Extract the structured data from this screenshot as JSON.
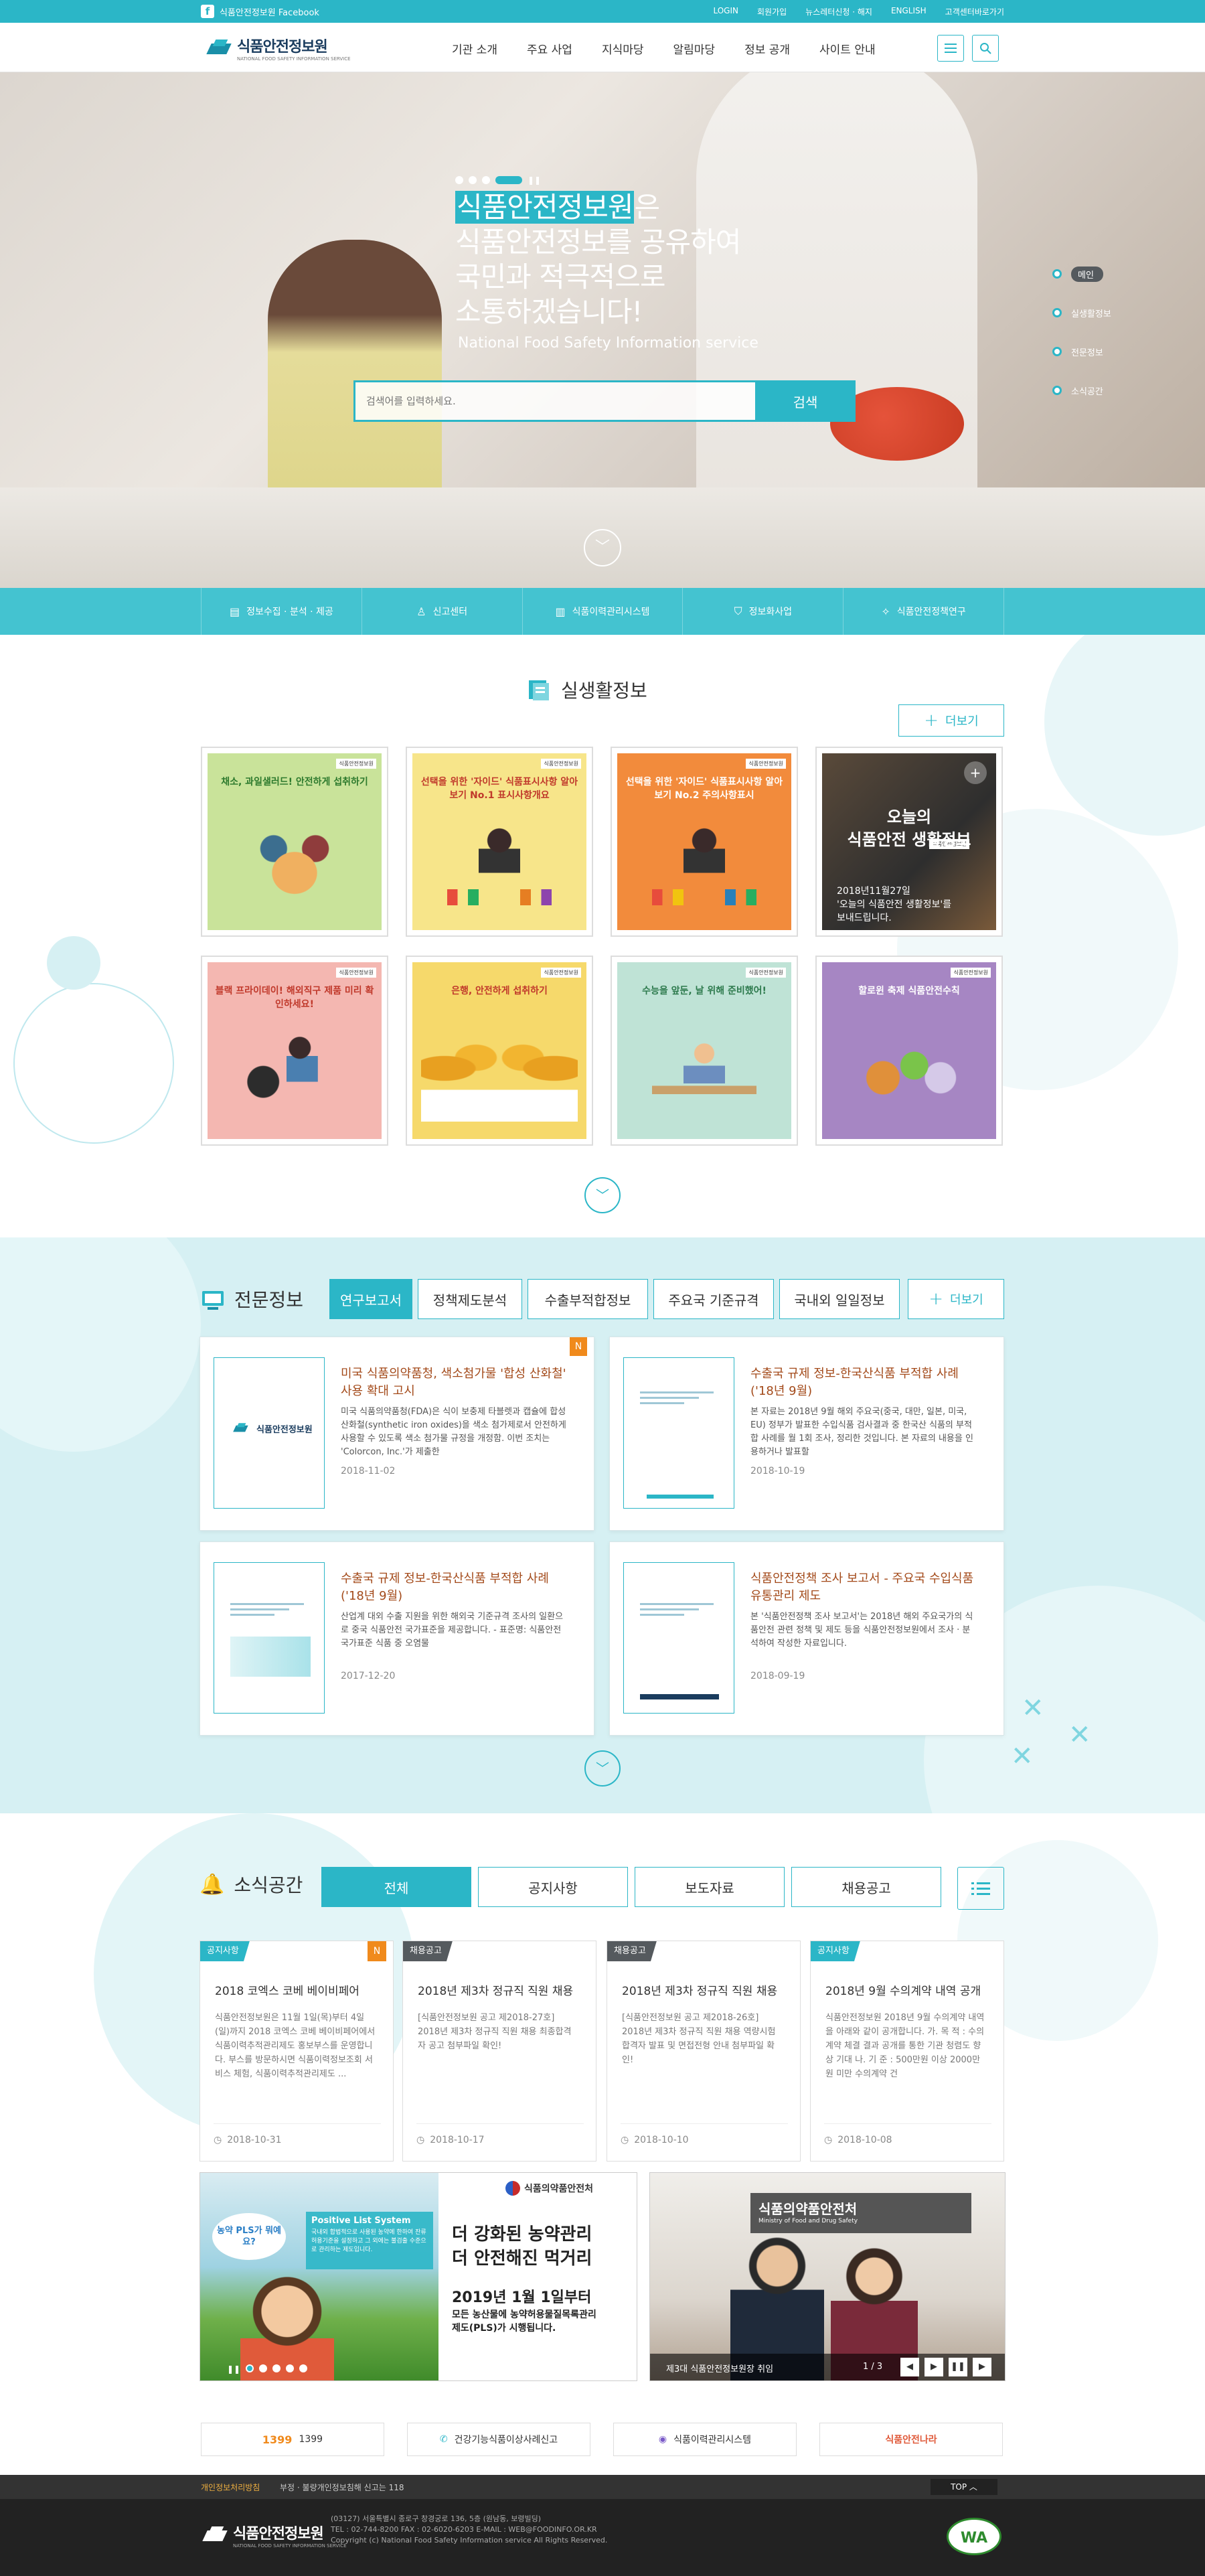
{
  "topbar": {
    "facebook": "식품안전정보원 Facebook",
    "util": [
      "LOGIN",
      "회원가입",
      "뉴스레터신청 · 해지",
      "ENGLISH",
      "고객센터바로가기"
    ]
  },
  "header": {
    "logo": "식품안전정보원",
    "logo_sub": "NATIONAL FOOD SAFETY INFORMATION SERVICE",
    "nav": [
      "기관 소개",
      "주요 사업",
      "지식마당",
      "알림마당",
      "정보 공개",
      "사이트 안내"
    ],
    "icons": [
      "menu-icon",
      "search-icon"
    ]
  },
  "hero": {
    "title_highlight": "식품안전정보원",
    "title_rest": "은",
    "title_line2": "식품안전정보를 공유하여",
    "title_line3": "국민과 적극적으로",
    "title_line4": "소통하겠습니다!",
    "subtitle": "National Food Safety Information service",
    "search_placeholder": "검색어를 입력하세요.",
    "search_button": "검색",
    "side_nav": [
      "메인",
      "실생활정보",
      "전문정보",
      "소식공간"
    ],
    "down_icon": "chevron-down-icon"
  },
  "quick": [
    {
      "label": "정보수집 · 분석 · 제공",
      "icon": "document-icon"
    },
    {
      "label": "신고센터",
      "icon": "person-icon"
    },
    {
      "label": "식품이력관리시스템",
      "icon": "barcode-icon"
    },
    {
      "label": "정보화사업",
      "icon": "shield-icon"
    },
    {
      "label": "식품안전정책연구",
      "icon": "handshake-icon"
    }
  ],
  "life": {
    "title": "실생활정보",
    "more": "더보기",
    "cards": [
      {
        "title": "채소, 과일샐러드! 안전하게 섭취하기",
        "bg": "#c9e39a",
        "title_color": "#2d7a2d"
      },
      {
        "title": "선택을 위한 '자이드' 식품표시사항 알아보기 No.1 표시사항개요",
        "bg": "#f7e58a",
        "title_color": "#c0392b"
      },
      {
        "title": "선택을 위한 '자이드' 식품표시사항 알아보기 No.2 주의사항표시",
        "bg": "#f28b3c",
        "title_color": "#ffffff"
      },
      {
        "title": "",
        "bg": "#3c3c3c",
        "title_color": "#ffffff"
      },
      {
        "title": "블랙 프라이데이! 해외직구 제품 미리 확인하세요!",
        "bg": "#f4b7b1",
        "title_color": "#c0392b"
      },
      {
        "title": "은행, 안전하게 섭취하기",
        "bg": "#f6d96b",
        "title_color": "#c0392b"
      },
      {
        "title": "수능을 앞둔, 날 위해 준비했어!",
        "bg": "#bfe3d6",
        "title_color": "#2d7a4d"
      },
      {
        "title": "할로윈 축제 식품안전수칙",
        "bg": "#a686c3",
        "title_color": "#ffffff"
      }
    ],
    "feature": {
      "title_line1": "오늘의",
      "title_line2": "식품안전 생활정보",
      "desc_line1": "2018년11월27일",
      "desc_line2": "'오늘의 식품안전 생활정보'를",
      "desc_line3": "보내드립니다."
    },
    "badge": "식품안전정보원"
  },
  "expert": {
    "title": "전문정보",
    "tabs": [
      "연구보고서",
      "정책제도분석",
      "수출부적합정보",
      "주요국 기준규격",
      "국내외 일일정보"
    ],
    "more": "더보기",
    "cards": [
      {
        "title": "미국 식품의약품청, 색소첨가물 '합성 산화철' 사용 확대 고시",
        "desc": "미국 식품의약품청(FDA)은 식이 보충제 타블렛과 캡슐에 합성 산화철(synthetic iron oxides)을 색소 첨가제로서 안전하게 사용할 수 있도록 색소 첨가물 규정을 개정함. 이번 조치는 'Colorcon, Inc.'가 제출한",
        "date": "2018-11-02",
        "new": "N"
      },
      {
        "title": "수출국 규제 정보-한국산식품 부적합 사례('18년 9월)",
        "desc": "본 자료는 2018년 9월 해외 주요국(중국, 대만, 일본, 미국, EU) 정부가 발표한 수입식품 검사결과 중 한국산 식품의 부적합 사례를 월 1회 조사, 정리한 것입니다. 본 자료의 내용을 인용하거나 발표할",
        "date": "2018-10-19",
        "new": ""
      },
      {
        "title": "수출국 규제 정보-한국산식품 부적합 사례('18년 9월)",
        "desc": "산업계 대외 수출 지원을 위한 해외국 기준규격 조사의 일환으로 중국 식품안전 국가표준을 제공합니다. - 표준명: 식품안전국가표준 식품 중 오염물",
        "date": "2017-12-20",
        "new": ""
      },
      {
        "title": "식품안전정책 조사 보고서 - 주요국 수입식품 유통관리 제도",
        "desc": "본 '식품안전정책 조사 보고서'는 2018년 해외 주요국가의 식품안전 관련 정책 및 제도 등을 식품안전정보원에서 조사 · 분석하여 작성한 자료입니다.",
        "date": "2018-09-19",
        "new": ""
      }
    ],
    "thumb_logo": "식품안전정보원"
  },
  "news": {
    "title": "소식공간",
    "tabs": [
      "전체",
      "공지사항",
      "보도자료",
      "채용공고"
    ],
    "cards": [
      {
        "cat": "공지사항",
        "cat_color": "#2bb6c7",
        "title": "2018 코엑스 코베 베이비페어",
        "desc": "식품안전정보원은 11월 1일(목)부터 4일(일)까지 2018 코엑스 코베 베이비페어에서 식품이력추적관리제도 홍보부스를 운영합니다. 부스를 방문하시면 식품이력정보조회 서비스 체험, 식품이력추적관리제도 ...",
        "date": "2018-10-31",
        "new": "N"
      },
      {
        "cat": "채용공고",
        "cat_color": "#555a5e",
        "title": "2018년 제3차 정규직 직원 채용",
        "desc": "[식품안전정보원 공고 제2018-27호] 2018년 제3차 정규직 직원 채용 최종합격자 공고 첨부파일 확인!",
        "date": "2018-10-17",
        "new": ""
      },
      {
        "cat": "채용공고",
        "cat_color": "#555a5e",
        "title": "2018년 제3차 정규직 직원 채용",
        "desc": "[식품안전정보원 공고 제2018-26호] 2018년 제3차 정규직 직원 채용 역량시험 합격자 발표 및 면접전형 안내 첨부파일 확인!",
        "date": "2018-10-10",
        "new": ""
      },
      {
        "cat": "공지사항",
        "cat_color": "#2bb6c7",
        "title": "2018년 9월 수의계약 내역 공개",
        "desc": "식품안전정보원 2018년 9월 수의계약 내역을 아래와 같이 공개합니다. 가. 목 적 : 수의계약 체결 결과 공개를 통한 기관 청렴도 향상 기대 나. 기 준 : 500만원 이상 2000만원 미만 수의계약 건",
        "date": "2018-10-08",
        "new": ""
      }
    ],
    "banner1": {
      "bubble": "농약 PLS가 뭐예요?",
      "pls_title": "Positive List System",
      "pls_desc": "국내외 합법적으로 사용된 농약에 한하여 잔류허용기준을 설정하고 그 외에는 불검출 수준으로 관리하는 제도입니다.",
      "org": "식품의약품안전처",
      "headline1": "더 강화된 농약관리",
      "headline2": "더 안전해진 먹거리",
      "date_line": "2019년 1월 1일부터",
      "body": "모든 농산물에 농약허용물질목록관리제도(PLS)가 시행됩니다."
    },
    "banner2": {
      "caption": "제3대 식품안전정보원장 취임",
      "counter": "1 / 3",
      "org": "식품의약품안전처",
      "org_en": "Ministry of Food and Drug Safety"
    }
  },
  "footlinks": [
    {
      "label": "1399",
      "icon": "1399"
    },
    {
      "label": "건강기능식품이상사례신고",
      "icon": "phone-icon"
    },
    {
      "label": "식품이력관리시스템",
      "icon": "barcode-icon"
    },
    {
      "label": "식품안전나라",
      "icon": "식품안전나라"
    }
  ],
  "footer": {
    "policy1": "개인정보처리방침",
    "policy2": "부정 · 불량개인정보침해 신고는 118",
    "top": "TOP",
    "address": "(03127) 서울특별시 종로구 창경궁로 136, 5층 (원남동, 보령빌딩)",
    "tel": "TEL : 02-744-8200 FAX : 02-6020-6203 E-MAIL : WEB@FOODINFO.OR.KR",
    "copyright": "Copyright (c) National Food Safety Information service All Rights Reserved.",
    "badge": "WA"
  }
}
